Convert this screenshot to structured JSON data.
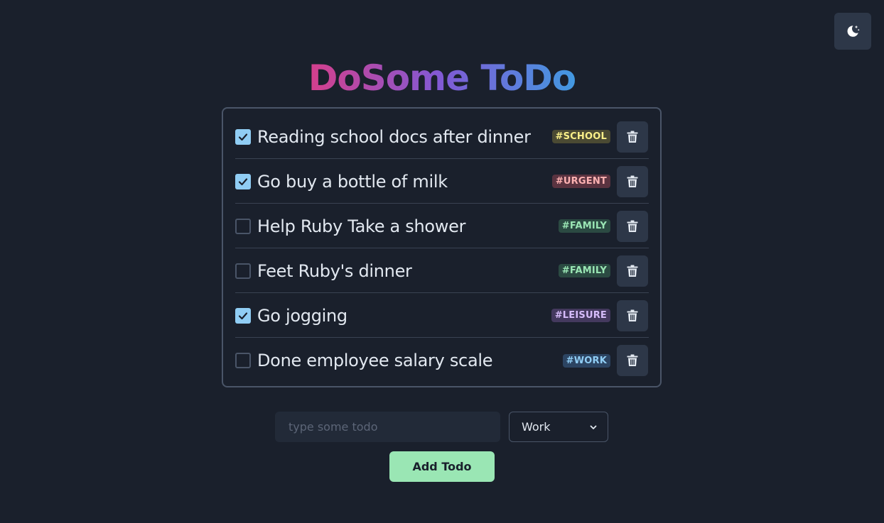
{
  "header": {
    "title": "DoSome ToDo",
    "theme_toggle_icon": "moon-stars-icon"
  },
  "todos": [
    {
      "text": "Reading school docs after dinner",
      "done": true,
      "tag": "#SCHOOL"
    },
    {
      "text": "Go buy a bottle of milk",
      "done": true,
      "tag": "#URGENT"
    },
    {
      "text": "Help Ruby Take a shower",
      "done": false,
      "tag": "#FAMILY"
    },
    {
      "text": "Feet Ruby's dinner",
      "done": false,
      "tag": "#FAMILY"
    },
    {
      "text": "Go jogging",
      "done": true,
      "tag": "#LEISURE"
    },
    {
      "text": "Done employee salary scale",
      "done": false,
      "tag": "#WORK"
    }
  ],
  "form": {
    "input_placeholder": "type some todo",
    "input_value": "",
    "category_selected": "Work",
    "add_label": "Add Todo"
  },
  "colors": {
    "background": "#1a202c",
    "checkbox_checked": "#90cdf4",
    "add_button": "#9ae6b4",
    "title_gradient": [
      "#d53f8c",
      "#805ad5",
      "#4299e1"
    ],
    "tag_school": "#faf089",
    "tag_urgent": "#feb2b2",
    "tag_family": "#9ae6b4",
    "tag_leisure": "#d6bcfa",
    "tag_work": "#90cdf4"
  }
}
